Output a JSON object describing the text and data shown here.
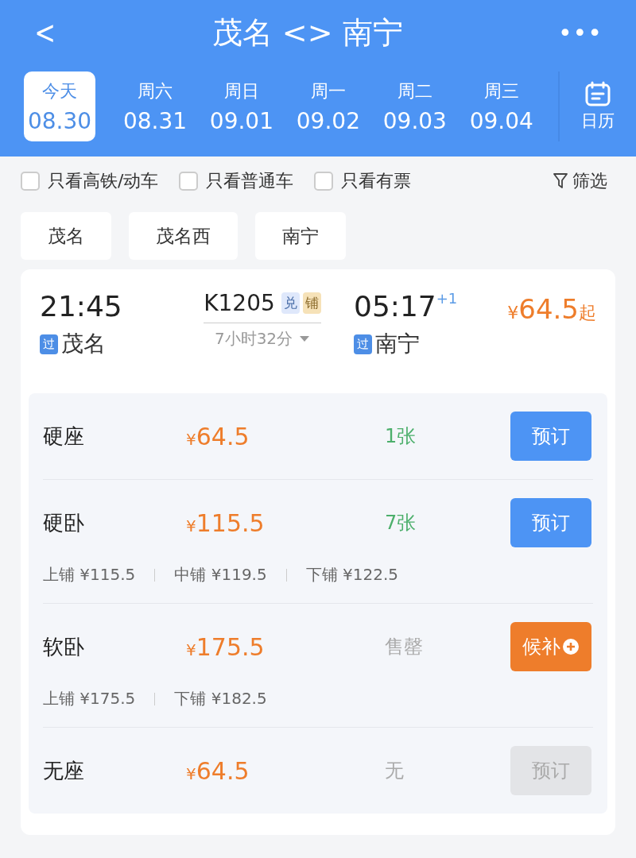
{
  "header": {
    "back": "<",
    "title": "茂名 <> 南宁",
    "more": "•••"
  },
  "dates": [
    {
      "day": "今天",
      "date": "08.30",
      "selected": true
    },
    {
      "day": "周六",
      "date": "08.31",
      "selected": false
    },
    {
      "day": "周日",
      "date": "09.01",
      "selected": false
    },
    {
      "day": "周一",
      "date": "09.02",
      "selected": false
    },
    {
      "day": "周二",
      "date": "09.03",
      "selected": false
    },
    {
      "day": "周三",
      "date": "09.04",
      "selected": false
    }
  ],
  "calendar": {
    "label": "日历"
  },
  "filters": [
    {
      "label": "只看高铁/动车",
      "checked": false
    },
    {
      "label": "只看普通车",
      "checked": false
    },
    {
      "label": "只看有票",
      "checked": false
    }
  ],
  "filter_button": {
    "label": "筛选"
  },
  "stations": [
    "茂名",
    "茂名西",
    "南宁"
  ],
  "train": {
    "depart_time": "21:45",
    "depart_tag": "过",
    "depart_station": "茂名",
    "number": "K1205",
    "badges": [
      {
        "label": "兑",
        "color": "#dfe8fb"
      },
      {
        "label": "铺",
        "color": "#f6e2b8"
      }
    ],
    "duration": "7小时32分",
    "arrive_time": "05:17",
    "day_offset": "+1",
    "arrive_tag": "过",
    "arrive_station": "南宁",
    "price": {
      "currency": "¥",
      "amount": "64.5",
      "suffix": "起"
    }
  },
  "seats": [
    {
      "name": "硬座",
      "currency": "¥",
      "amount": "64.5",
      "availability": "1张",
      "available": true,
      "button": {
        "label": "预订",
        "kind": "book"
      }
    },
    {
      "name": "硬卧",
      "currency": "¥",
      "amount": "115.5",
      "availability": "7张",
      "available": true,
      "button": {
        "label": "预订",
        "kind": "book"
      },
      "berths": [
        "上铺 ¥115.5",
        "中铺 ¥119.5",
        "下铺 ¥122.5"
      ]
    },
    {
      "name": "软卧",
      "currency": "¥",
      "amount": "175.5",
      "availability": "售罄",
      "available": false,
      "button": {
        "label": "候补",
        "kind": "waitlist"
      },
      "berths": [
        "上铺 ¥175.5",
        "下铺 ¥182.5"
      ]
    },
    {
      "name": "无座",
      "currency": "¥",
      "amount": "64.5",
      "availability": "无",
      "available": false,
      "button": {
        "label": "预订",
        "kind": "disabled"
      }
    }
  ]
}
